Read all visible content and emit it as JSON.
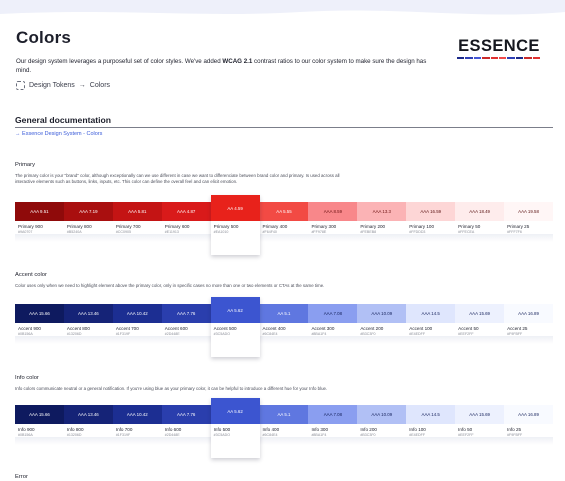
{
  "page": {
    "title": "Colors",
    "intro_prefix": "Our design system leverages a purposeful set of color styles. We've added ",
    "intro_bold": "WCAG 2.1",
    "intro_suffix": " contrast ratios to our color system to make sure the design has mind.",
    "breadcrumb": [
      "Design Tokens",
      "Colors"
    ],
    "breadcrumb_separator": "→"
  },
  "logo": {
    "text": "ESSENCE",
    "bar_colors": [
      "#1c2a8a",
      "#2e3fb5",
      "#4557d6",
      "#c92a2a",
      "#e03131",
      "#f04a4a",
      "#2e3fb5",
      "#1c2a8a",
      "#c92a2a",
      "#e03131"
    ]
  },
  "section": {
    "title": "General documentation",
    "link": "→ Essence Design System - Colors"
  },
  "groups": [
    {
      "key": "primary",
      "title": "Primary",
      "description": "The primary color is your \"brand\" color, although exceptionally can we use different in case we want to differenciate between brand color and primary. Is used across all interactive elements such as buttons, links, inputs, etc. This color can define the overall feel and can elicit emotion.",
      "swatches": [
        {
          "ratio": "AAA 9.51",
          "name": "Primary 900",
          "hex": "#9A0707",
          "color": "#8f0a0a",
          "text_color": "#ffffff"
        },
        {
          "ratio": "AAA 7.19",
          "name": "Primary 800",
          "hex": "#B5240A",
          "color": "#a90f0f",
          "text_color": "#ffffff"
        },
        {
          "ratio": "AAA 5.81",
          "name": "Primary 700",
          "hex": "#CC0905",
          "color": "#c41414",
          "text_color": "#ffffff"
        },
        {
          "ratio": "AAA 4.87",
          "name": "Primary 600",
          "hex": "#E11913",
          "color": "#d91a1a",
          "text_color": "#ffffff"
        },
        {
          "ratio": "AA 4.59",
          "name": "Primary 500",
          "hex": "#EA1010",
          "color": "#e8221b",
          "text_color": "#ffffff",
          "raised": true
        },
        {
          "ratio": "AA 5.55",
          "name": "Primary 400",
          "hex": "#F64F40",
          "color": "#f24a44",
          "text_color": "#ffffff"
        },
        {
          "ratio": "AAA 8.59",
          "name": "Primary 300",
          "hex": "#FF978E",
          "color": "#f8878a",
          "text_color": "#6e1414"
        },
        {
          "ratio": "AAA 13.3",
          "name": "Primary 200",
          "hex": "#FEBEB8",
          "color": "#fbb3b5",
          "text_color": "#6e1414"
        },
        {
          "ratio": "AAA 16.59",
          "name": "Primary 100",
          "hex": "#FFDDD3",
          "color": "#fdd6d6",
          "text_color": "#5a1212"
        },
        {
          "ratio": "AAA 18.49",
          "name": "Primary 50",
          "hex": "#FFECEA",
          "color": "#feecec",
          "text_color": "#5a1212"
        },
        {
          "ratio": "AAA 19.58",
          "name": "Primary 25",
          "hex": "#FFF7F6",
          "color": "#fff6f6",
          "text_color": "#5a1212"
        }
      ]
    },
    {
      "key": "accent",
      "title": "Accent color",
      "description": "Color uses only when we need to highlight element above the primary color, only in specific cases no more than one or two elements or CTAs at the same time.",
      "swatches": [
        {
          "ratio": "AAA 15.66",
          "name": "Accent 900",
          "hex": "#0B156A",
          "color": "#0e1a5f",
          "text_color": "#ffffff"
        },
        {
          "ratio": "AAA 13.46",
          "name": "Accent 800",
          "hex": "#13206D",
          "color": "#152377",
          "text_color": "#ffffff"
        },
        {
          "ratio": "AAA 10.42",
          "name": "Accent 700",
          "hex": "#1F319F",
          "color": "#1c2e92",
          "text_color": "#ffffff"
        },
        {
          "ratio": "AAA 7.76",
          "name": "Accent 600",
          "hex": "#2D448E",
          "color": "#2a3ead",
          "text_color": "#ffffff"
        },
        {
          "ratio": "AA 5.62",
          "name": "Accent 500",
          "hex": "#3C5ADO",
          "color": "#3c55d0",
          "text_color": "#ffffff",
          "raised": true
        },
        {
          "ratio": "AA 5.1",
          "name": "Accent 400",
          "hex": "#6C84E4",
          "color": "#5f77e0",
          "text_color": "#ffffff"
        },
        {
          "ratio": "AAA 7.08",
          "name": "Accent 300",
          "hex": "#8BA1F4",
          "color": "#8a9ef0",
          "text_color": "#16225c"
        },
        {
          "ratio": "AAA 10.09",
          "name": "Accent 200",
          "hex": "#B3C3F0",
          "color": "#b1c0f5",
          "text_color": "#16225c"
        },
        {
          "ratio": "AAA 14.5",
          "name": "Accent 100",
          "hex": "#E4EDFF",
          "color": "#dfe6fd",
          "text_color": "#16225c"
        },
        {
          "ratio": "AAA 15.69",
          "name": "Accent 50",
          "hex": "#EEF2FF",
          "color": "#edf1fe",
          "text_color": "#16225c"
        },
        {
          "ratio": "AAA 16.89",
          "name": "Accent 25",
          "hex": "#F9FBFF",
          "color": "#f8faff",
          "text_color": "#16225c"
        }
      ]
    },
    {
      "key": "info",
      "title": "Info color",
      "description": "Info colors communicate neutral or a general notification. If you're using blue as your primary color, it can be helpful to introduce a different hue for your Info blue.",
      "swatches": [
        {
          "ratio": "AAA 15.66",
          "name": "Info 900",
          "hex": "#0B156A",
          "color": "#0e1a5f",
          "text_color": "#ffffff"
        },
        {
          "ratio": "AAA 13.46",
          "name": "Info 800",
          "hex": "#13206D",
          "color": "#152377",
          "text_color": "#ffffff"
        },
        {
          "ratio": "AAA 10.42",
          "name": "Info 700",
          "hex": "#1F319F",
          "color": "#1c2e92",
          "text_color": "#ffffff"
        },
        {
          "ratio": "AAA 7.76",
          "name": "Info 600",
          "hex": "#2D448E",
          "color": "#2a3ead",
          "text_color": "#ffffff"
        },
        {
          "ratio": "AA 5.62",
          "name": "Info 500",
          "hex": "#3C5ADO",
          "color": "#3c55d0",
          "text_color": "#ffffff",
          "raised": true
        },
        {
          "ratio": "AA 5.1",
          "name": "Info 400",
          "hex": "#6C84E4",
          "color": "#5f77e0",
          "text_color": "#ffffff"
        },
        {
          "ratio": "AAA 7.08",
          "name": "Info 300",
          "hex": "#8BA1F4",
          "color": "#8a9ef0",
          "text_color": "#16225c"
        },
        {
          "ratio": "AAA 10.09",
          "name": "Info 200",
          "hex": "#B3C3F0",
          "color": "#b1c0f5",
          "text_color": "#16225c"
        },
        {
          "ratio": "AAA 14.5",
          "name": "Info 100",
          "hex": "#E4EDFF",
          "color": "#dfe6fd",
          "text_color": "#16225c"
        },
        {
          "ratio": "AAA 15.69",
          "name": "Info 50",
          "hex": "#EEF2FF",
          "color": "#edf1fe",
          "text_color": "#16225c"
        },
        {
          "ratio": "AAA 16.89",
          "name": "Info 25",
          "hex": "#F9FBFF",
          "color": "#f8faff",
          "text_color": "#16225c"
        }
      ]
    }
  ],
  "next_group_title_partial": "Error"
}
